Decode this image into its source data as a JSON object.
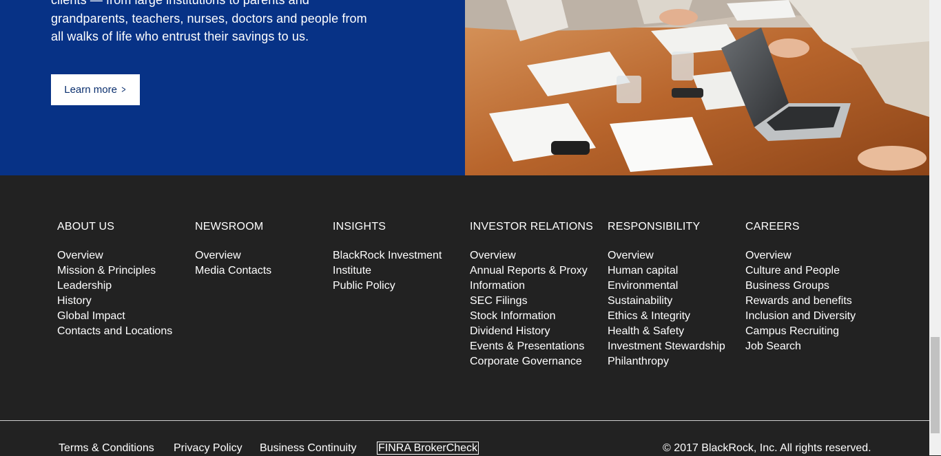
{
  "hero": {
    "text_lines": [
      "clients — from large institutions to parents and",
      "grandparents, teachers, nurses, doctors and people from",
      "all walks of life who entrust their savings to us."
    ],
    "learn_more_label": "Learn more",
    "learn_more_chevron": ">",
    "image_icon": "business-meeting-photo"
  },
  "footer": {
    "columns": [
      {
        "heading": "ABOUT US",
        "links": [
          "Overview",
          "Mission & Principles",
          "Leadership",
          "History",
          "Global Impact",
          "Contacts and Locations"
        ]
      },
      {
        "heading": "NEWSROOM",
        "links": [
          "Overview",
          "Media Contacts"
        ]
      },
      {
        "heading": "INSIGHTS",
        "links": [
          "BlackRock Investment",
          "Institute",
          "Public Policy"
        ]
      },
      {
        "heading": "INVESTOR RELATIONS",
        "links": [
          "Overview",
          "Annual Reports & Proxy",
          "Information",
          "SEC Filings",
          "Stock Information",
          "Dividend History",
          "Events & Presentations",
          "Corporate Governance"
        ]
      },
      {
        "heading": "RESPONSIBILITY",
        "links": [
          "Overview",
          "Human capital",
          "Environmental",
          "Sustainability",
          "Ethics & Integrity",
          "Health & Safety",
          "Investment Stewardship",
          "Philanthropy"
        ]
      },
      {
        "heading": "CAREERS",
        "links": [
          "Overview",
          "Culture and People",
          "Business Groups",
          "Rewards and benefits",
          "Inclusion and Diversity",
          "Campus Recruiting",
          "Job Search"
        ]
      }
    ],
    "legal_links": [
      "Terms & Conditions",
      "Privacy Policy",
      "Business Continuity",
      "FINRA BrokerCheck"
    ],
    "copyright": "© 2017 BlackRock, Inc. All rights reserved."
  },
  "colors": {
    "hero_blue": "#073286",
    "footer_bg": "#222222",
    "text": "#ffffff"
  }
}
